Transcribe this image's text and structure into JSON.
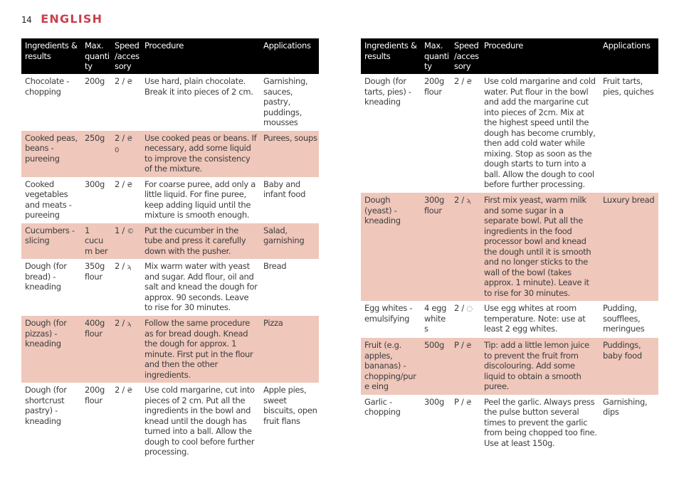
{
  "page": {
    "number": "14",
    "section_title": "ENGLISH",
    "accent_color": "#c8404a",
    "shade_color": "#efc7bb"
  },
  "headers": {
    "ingredients": "Ingredients & results",
    "quantity": "Max. quanti ty",
    "speed": "Speed /acces sory",
    "procedure": "Procedure",
    "applications": "Applications"
  },
  "left_table": {
    "rows": [
      {
        "ingredient": "Chocolate - chopping",
        "quantity": "200g",
        "speed": "2 / ",
        "accessory_icon": "blade-icon",
        "accessory_glyph": "₴",
        "procedure": "Use hard, plain chocolate. Break it into pieces of 2 cm.",
        "applications": "Garnishing, sauces, pastry, puddings, mousses",
        "shaded": false
      },
      {
        "ingredient": "Cooked peas, beans - pureeing",
        "quantity": "250g",
        "speed": "2 / ",
        "accessory_icon": "blade-icon",
        "accessory_glyph": "₴",
        "accessory_extra_icon": "disc-icon",
        "accessory_extra_glyph": "0",
        "procedure": "Use cooked peas or beans. If necessary, add some liquid to improve the consistency of the mixture.",
        "applications": "Purees, soups",
        "shaded": true
      },
      {
        "ingredient": "Cooked vegetables and meats - pureeing",
        "quantity": "300g",
        "speed": "2 / ",
        "accessory_icon": "blade-icon",
        "accessory_glyph": "₴",
        "procedure": "For coarse puree, add only a little liquid. For fine puree, keep adding liquid until the mixture is smooth enough.",
        "applications": "Baby and infant food",
        "shaded": false
      },
      {
        "ingredient": "Cucumbers - slicing",
        "quantity": "1 cucum ber",
        "speed": "1 / ",
        "accessory_icon": "slicing-disc-icon",
        "accessory_glyph": "©",
        "procedure": "Put the cucumber in the tube and press it carefully down with the pusher.",
        "applications": "Salad, garnishing",
        "shaded": true
      },
      {
        "ingredient": "Dough (for bread) - kneading",
        "quantity": "350g flour",
        "speed": "2 / ",
        "accessory_icon": "dough-hook-icon",
        "accessory_glyph": "ϡ",
        "procedure": "Mix warm water with yeast and sugar. Add flour, oil and salt and knead the dough for approx. 90 seconds. Leave to rise for 30 minutes.",
        "applications": "Bread",
        "shaded": false
      },
      {
        "ingredient": "Dough (for pizzas) - kneading",
        "quantity": "400g flour",
        "speed": "2 / ",
        "accessory_icon": "dough-hook-icon",
        "accessory_glyph": "ϡ",
        "procedure": "Follow the same procedure as for bread dough. Knead the dough for approx. 1 minute. First put in the flour and then the other ingredients.",
        "applications": "Pizza",
        "shaded": true
      },
      {
        "ingredient": "Dough (for shortcrust pastry) - kneading",
        "quantity": "200g flour",
        "speed": "2 / ",
        "accessory_icon": "blade-icon",
        "accessory_glyph": "₴",
        "procedure": "Use cold margarine, cut into pieces of 2 cm. Put all the ingredients in the bowl and knead until the dough has turned into a ball. Allow the dough to cool before further processing.",
        "applications": "Apple pies, sweet biscuits, open fruit flans",
        "shaded": false
      }
    ]
  },
  "right_table": {
    "rows": [
      {
        "ingredient": "Dough (for tarts, pies) - kneading",
        "quantity": "200g flour",
        "speed": "2 / ",
        "accessory_icon": "blade-icon",
        "accessory_glyph": "₴",
        "procedure": "Use cold margarine and cold water. Put flour in the bowl and add the margarine cut into pieces of 2cm. Mix at the highest speed until the dough has become crumbly, then add cold water while mixing. Stop as soon as the dough starts to turn into a ball. Allow the dough to cool before further processing.",
        "applications": "Fruit tarts, pies, quiches",
        "shaded": false
      },
      {
        "ingredient": "Dough (yeast) - kneading",
        "quantity": "300g flour",
        "speed": "2 / ",
        "accessory_icon": "dough-hook-icon",
        "accessory_glyph": "ϡ",
        "procedure": "First mix yeast, warm milk and some sugar in a separate bowl. Put all the ingredients in the food processor bowl and knead the dough until it is smooth and no longer sticks to the wall of the bowl (takes approx. 1 minute). Leave it to rise for 30 minutes.",
        "applications": "Luxury bread",
        "shaded": true
      },
      {
        "ingredient": "Egg whites - emulsifying",
        "quantity": "4 egg whites",
        "speed": "2 / ",
        "accessory_icon": "emulsifying-disc-icon",
        "accessory_glyph": "◌",
        "procedure": "Use egg whites at room temperature. Note: use at least 2 egg whites.",
        "applications": "Pudding, soufflees, meringues",
        "shaded": false
      },
      {
        "ingredient": "Fruit (e.g. apples, bananas) - chopping/pure eing",
        "quantity": "500g",
        "speed": "P / ",
        "accessory_icon": "blade-icon",
        "accessory_glyph": "₴",
        "procedure": "Tip: add a little lemon juice to prevent the fruit from discolouring. Add some liquid to obtain a smooth puree.",
        "applications": "Puddings, baby food",
        "shaded": true
      },
      {
        "ingredient": "Garlic - chopping",
        "quantity": "300g",
        "speed": "P / ",
        "accessory_icon": "blade-icon",
        "accessory_glyph": "₴",
        "procedure": "Peel the garlic. Always press the pulse button several times to prevent the garlic from being chopped too fine. Use at least 150g.",
        "applications": "Garnishing, dips",
        "shaded": false
      }
    ]
  }
}
